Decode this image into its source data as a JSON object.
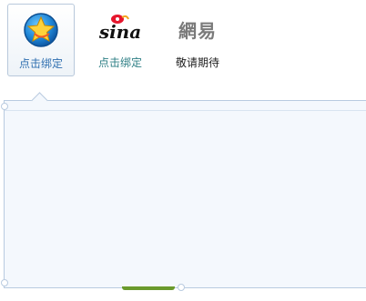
{
  "providers": [
    {
      "name": "qq",
      "label": "点击绑定",
      "icon": "star-shield-icon",
      "selected": true
    },
    {
      "name": "sina",
      "label": "点击绑定",
      "icon": "sina-weibo-logo-icon",
      "logo_text": "sina",
      "selected": false
    },
    {
      "name": "netease",
      "label": "敬请期待",
      "icon": "netease-logo-icon",
      "logo_text": "網易",
      "selected": false
    }
  ],
  "colors": {
    "label_blue": "#2f6fb0",
    "label_teal": "#2e7f85",
    "panel_bg": "#f4f8fd",
    "panel_border": "#b9cbe0",
    "accent_green": "#6a9a2c"
  }
}
